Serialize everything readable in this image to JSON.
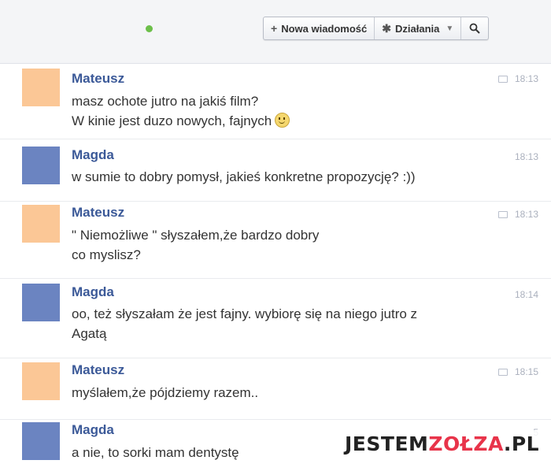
{
  "toolbar": {
    "new_message_label": "Nowa wiadomość",
    "actions_label": "Działania",
    "new_message_icon": "plus-icon",
    "actions_icon": "gear-icon",
    "search_icon": "search-icon"
  },
  "messages": [
    {
      "sender": "Mateusz",
      "lines": [
        "masz ochote jutro na jakiś film?",
        "W kinie jest duzo nowych, fajnych"
      ],
      "time": "18:13",
      "emoji": "smiley"
    },
    {
      "sender": "Magda",
      "lines": [
        "w sumie to dobry pomysł, jakieś konkretne propozycję? :))"
      ],
      "time": "18:13"
    },
    {
      "sender": "Mateusz",
      "lines": [
        "\" Niemożliwe \" słyszałem,że bardzo dobry",
        "co myslisz?"
      ],
      "time": "18:13"
    },
    {
      "sender": "Magda",
      "lines": [
        "oo, też słyszałam że jest fajny. wybiorę się na niego jutro z",
        "Agatą"
      ],
      "time": "18:14"
    },
    {
      "sender": "Mateusz",
      "lines": [
        "myślałem,że pójdziemy razem.."
      ],
      "time": "18:15"
    },
    {
      "sender": "Magda",
      "lines": [
        "a nie, to sorki mam dentystę"
      ],
      "time": "5"
    }
  ],
  "watermark": {
    "part1": "JESTEM",
    "part2": "ZOŁZA",
    "part3": ".PL"
  },
  "colors": {
    "sender_name": "#3b5998",
    "avatar_mateusz": "#fbc796",
    "avatar_magda": "#6b84c1",
    "status_online": "#6cbf4a"
  }
}
